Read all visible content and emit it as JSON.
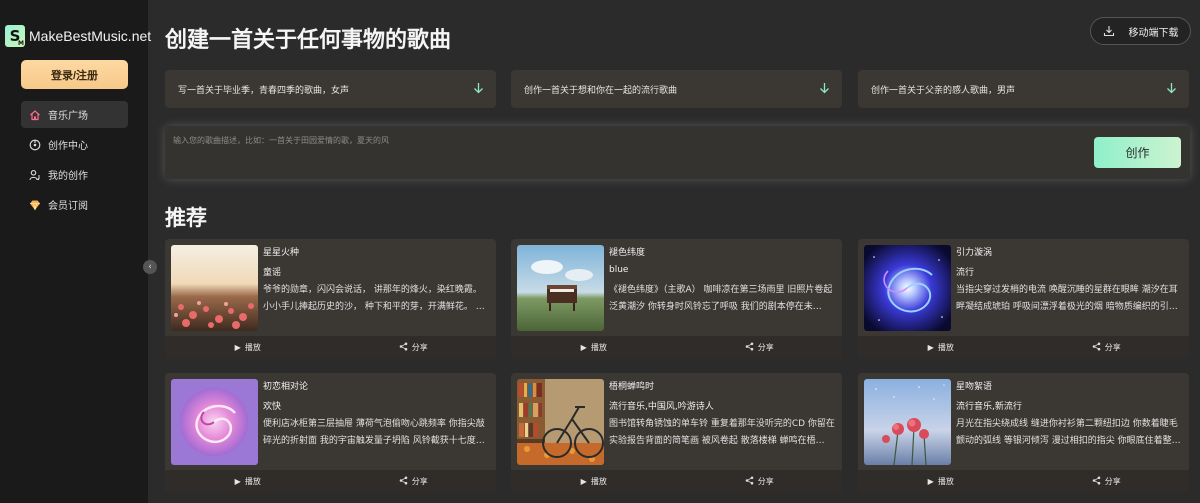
{
  "brand": {
    "badge_letter": "S",
    "badge_sub": "M",
    "name": "MakeBestMusic.net"
  },
  "sidebar": {
    "login_label": "登录/注册",
    "items": [
      {
        "label": "音乐广场",
        "icon": "home-icon",
        "active": true
      },
      {
        "label": "创作中心",
        "icon": "music-disc-icon",
        "active": false
      },
      {
        "label": "我的创作",
        "icon": "user-music-icon",
        "active": false
      },
      {
        "label": "会员订阅",
        "icon": "diamond-icon",
        "active": false
      }
    ],
    "collapse_glyph": "‹"
  },
  "header": {
    "title": "创建一首关于任何事物的歌曲",
    "download_label": "移动端下载"
  },
  "suggestions": [
    {
      "text": "写一首关于毕业季，青春四季的歌曲，女声"
    },
    {
      "text": "创作一首关于想和你在一起的流行歌曲"
    },
    {
      "text": "创作一首关于父亲的感人歌曲，男声"
    }
  ],
  "prompt": {
    "placeholder": "输入您的歌曲描述，比如：一首关于田园爱情的歌，夏天的风",
    "create_label": "创作"
  },
  "recommend": {
    "title": "推荐",
    "play_label": "播放",
    "share_label": "分享",
    "cards": [
      {
        "title": "星星火种",
        "genre": "童谣",
        "desc": "爷爷的勋章，闪闪会说话， 讲那年的烽火，染红晚霞。 小小手儿捧起历史的沙， 种下和平的芽，开满鲜花。 …",
        "cover": "flower-field-sunset"
      },
      {
        "title": "褪色纬度",
        "genre": "blue",
        "desc": "《褪色纬度》（主歌A） 咖啡凉在第三场雨里 旧照片卷起泛黄潮汐 你转身时风铃忘了呼吸 我们的剧本停在未…",
        "cover": "piano-on-hill"
      },
      {
        "title": "引力漩涡",
        "genre": "流行",
        "desc": "当指尖穿过发梢的电流 唤醒沉睡的星群在眼眸 潮汐在耳畔凝结成琥珀 呼吸间漂浮着极光的烟 暗物质编织的引…",
        "cover": "galaxy-vortex"
      },
      {
        "title": "初恋相对论",
        "genre": "欢快",
        "desc": "便利店冰柜第三层抽屉 薄荷气泡偷吻心跳频率 你指尖敲碎光的折射面 我的宇宙触发量子坍陷 风铃截获十七度…",
        "cover": "pink-swirl"
      },
      {
        "title": "梧桐蝉鸣时",
        "genre": "流行音乐,中国风,吟游诗人",
        "desc": "图书馆转角锈蚀的单车铃 重复着那年没听完的CD 你留在实验报告背面的简笔画 被风卷起 散落楼梯 蝉鸣在梧…",
        "cover": "bicycle-library"
      },
      {
        "title": "星吻絮语",
        "genre": "流行音乐,新流行",
        "desc": "月光在指尖绕成线 缝进你衬衫第二颗纽扣边 你数着睫毛颤动的弧线 等银河倾泻 漫过相扣的指尖 你眼底住着整…",
        "cover": "roses-dusk"
      }
    ]
  }
}
